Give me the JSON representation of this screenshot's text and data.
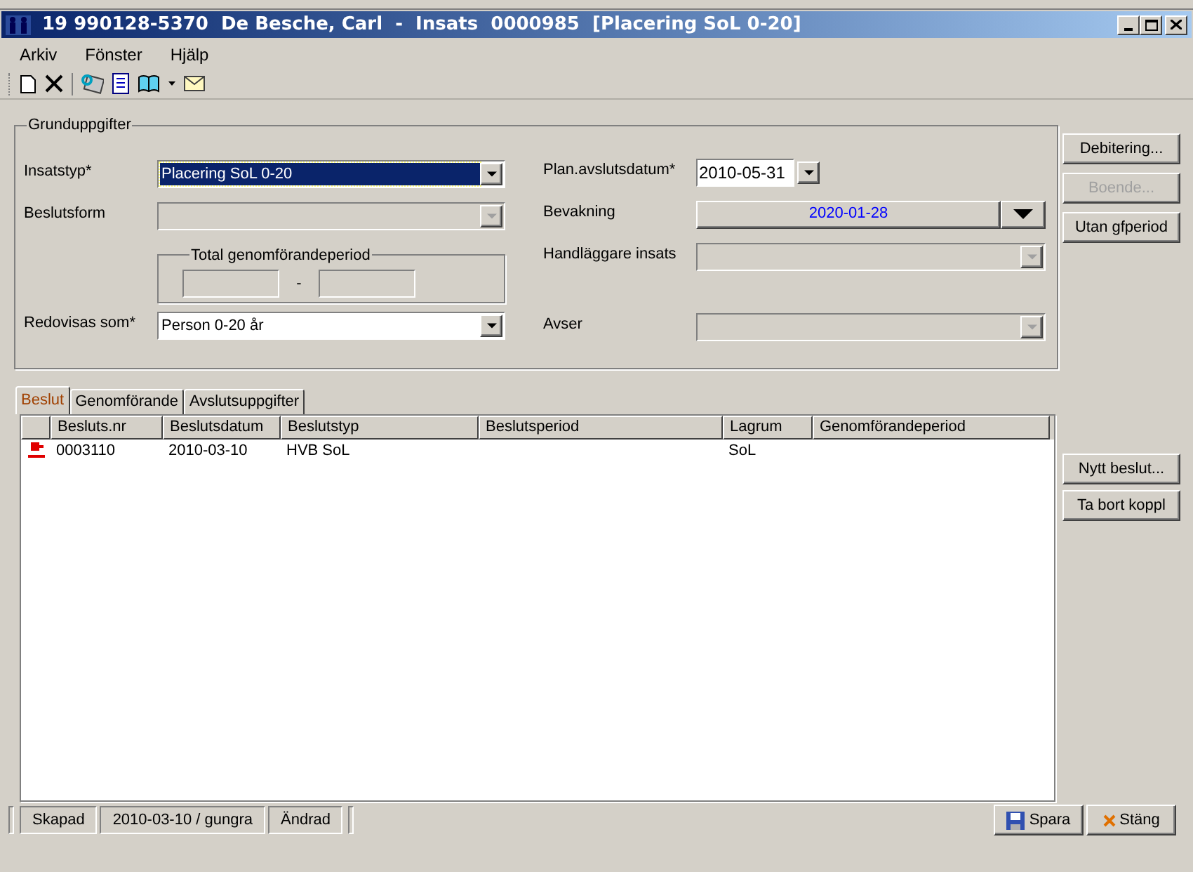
{
  "window": {
    "title": "19 990128-5370  De Besche, Carl  -  Insats  0000985  [Placering SoL 0-20]"
  },
  "menu": [
    "Arkiv",
    "Fönster",
    "Hjälp"
  ],
  "basic_info": {
    "title": "Grunduppgifter",
    "left_fields": [
      {
        "label": "Insatstyp*",
        "kind": "combo",
        "value": "Placering SoL 0-20",
        "disabled": false,
        "focused": true
      },
      {
        "label": "Beslutsform",
        "kind": "combo",
        "disabled": true,
        "focused": false
      },
      {
        "kind": "period",
        "title": "Total genomförandeperiod",
        "separator": "-"
      },
      {
        "label": "Redovisas som*",
        "kind": "combo",
        "value": "Person 0-20 år",
        "disabled": false,
        "focused": false
      }
    ],
    "right_fields": [
      {
        "label": "Plan.avslutsdatum*",
        "kind": "date",
        "value": "2010-05-31",
        "disabled": false
      },
      {
        "label": "Bevakning",
        "kind": "button_combo",
        "value": "2020-01-28",
        "disabled": false
      },
      {
        "label": "Handläggare insats",
        "kind": "combo",
        "disabled": true
      },
      {
        "label": "Avser",
        "kind": "combo",
        "disabled": true
      }
    ]
  },
  "side_buttons": [
    {
      "label": "Debitering...",
      "disabled": false
    },
    {
      "label": "Boende...",
      "disabled": true
    },
    {
      "label": "Utan gfperiod",
      "disabled": false
    }
  ],
  "tabs": [
    {
      "label": "Beslut",
      "selected": true
    },
    {
      "label": "Genomförande",
      "selected": false
    },
    {
      "label": "Avslutsuppgifter",
      "selected": false
    }
  ],
  "table": {
    "columns": [
      "Besluts.nr",
      "Beslutsdatum",
      "Beslutstyp",
      "Beslutsperiod",
      "Lagrum",
      "Genomförandeperiod"
    ],
    "rows": [
      {
        "cells": [
          "0003110",
          "2010-03-10",
          "HVB SoL",
          "",
          "SoL",
          ""
        ]
      }
    ]
  },
  "table_buttons": [
    "Nytt beslut...",
    "Ta bort koppl"
  ],
  "status_bar": [
    "Skapad",
    "2010-03-10 / gungra",
    "Ändrad"
  ],
  "footer_buttons": [
    {
      "label": "Spara",
      "kind": "save"
    },
    {
      "label": "Stäng",
      "kind": "close"
    }
  ]
}
